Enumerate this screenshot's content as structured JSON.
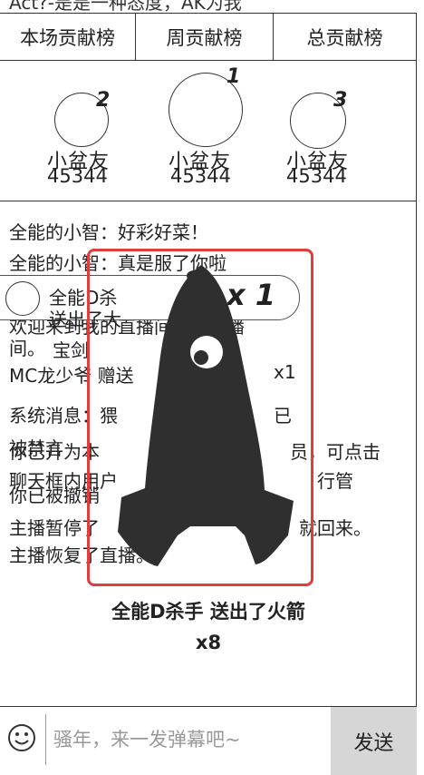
{
  "top_notice": "Act?-是是一种态度，AK为我",
  "tabs": [
    "本场贡献榜",
    "周贡献榜",
    "总贡献榜"
  ],
  "ranks": [
    {
      "num": "2",
      "name": "小盆友",
      "score": "45344"
    },
    {
      "num": "1",
      "name": "小盆友",
      "score": "45344"
    },
    {
      "num": "3",
      "name": "小盆友",
      "score": "45344"
    }
  ],
  "chat": [
    "全能的小智：好彩好菜！",
    "全能的小智：真是服了你啦",
    "欢迎来到我的直播间，我直播",
    "间。",
    "MC龙少爷 赠送",
    "x1",
    "系统消息：猥",
    "已",
    "被禁言",
    "你已升为本",
    "员，可点击",
    "聊天框内用户",
    "行管",
    "你已被撤销",
    "主播暂停了",
    "就回来。",
    "主播恢复了直播。"
  ],
  "banner": {
    "name": "全能D杀",
    "action": "送出了大",
    "extra": "宝剑",
    "multiplier": "x 1"
  },
  "gift_caption": {
    "line1": "全能D杀手 送出了火箭",
    "line2": "x8"
  },
  "input": {
    "placeholder": "骚年，来一发弹幕吧~"
  },
  "send_label": "发送",
  "icons": {
    "emoji": "smile-icon",
    "gift": "rocket-icon"
  },
  "colors": {
    "highlight_border": "#e23c3c",
    "send_bg": "#d6d6d6",
    "rocket": "#2f2f2f"
  }
}
